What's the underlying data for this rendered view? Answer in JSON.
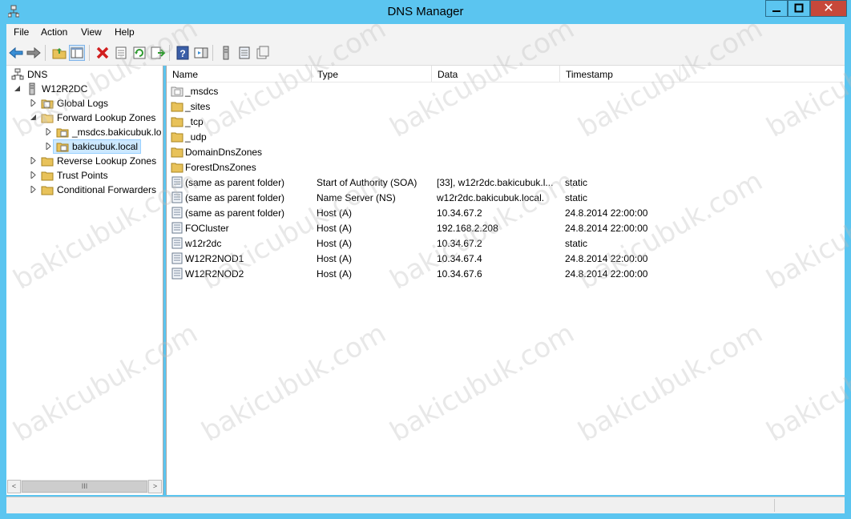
{
  "window": {
    "title": "DNS Manager",
    "close_glyph": "✕"
  },
  "menu": [
    "File",
    "Action",
    "View",
    "Help"
  ],
  "toolbar_icons": [
    "back-arrow-icon",
    "forward-arrow-icon",
    "up-folder-icon",
    "show-hide-console-tree-icon",
    "delete-icon",
    "properties-icon",
    "refresh-icon",
    "export-list-icon",
    "help-icon",
    "show-hide-action-pane-icon",
    "server-icon",
    "zone-icon",
    "record-icon"
  ],
  "tree": {
    "root": "DNS",
    "server": "W12R2DC",
    "nodes": [
      {
        "label": "Global Logs"
      },
      {
        "label": "Forward Lookup Zones"
      },
      {
        "label": "_msdcs.bakicubuk.lo"
      },
      {
        "label": "bakicubuk.local"
      },
      {
        "label": "Reverse Lookup Zones"
      },
      {
        "label": "Trust Points"
      },
      {
        "label": "Conditional Forwarders"
      }
    ]
  },
  "list": {
    "columns": [
      "Name",
      "Type",
      "Data",
      "Timestamp"
    ],
    "rows": [
      {
        "name": "_msdcs",
        "type": "",
        "data": "",
        "timestamp": "",
        "icon": "folder-grey-icon"
      },
      {
        "name": "_sites",
        "type": "",
        "data": "",
        "timestamp": "",
        "icon": "folder-icon"
      },
      {
        "name": "_tcp",
        "type": "",
        "data": "",
        "timestamp": "",
        "icon": "folder-icon"
      },
      {
        "name": "_udp",
        "type": "",
        "data": "",
        "timestamp": "",
        "icon": "folder-icon"
      },
      {
        "name": "DomainDnsZones",
        "type": "",
        "data": "",
        "timestamp": "",
        "icon": "folder-icon"
      },
      {
        "name": "ForestDnsZones",
        "type": "",
        "data": "",
        "timestamp": "",
        "icon": "folder-icon"
      },
      {
        "name": "(same as parent folder)",
        "type": "Start of Authority (SOA)",
        "data": "[33], w12r2dc.bakicubuk.l...",
        "timestamp": "static",
        "icon": "record-icon"
      },
      {
        "name": "(same as parent folder)",
        "type": "Name Server (NS)",
        "data": "w12r2dc.bakicubuk.local.",
        "timestamp": "static",
        "icon": "record-icon"
      },
      {
        "name": "(same as parent folder)",
        "type": "Host (A)",
        "data": "10.34.67.2",
        "timestamp": "24.8.2014 22:00:00",
        "icon": "record-icon"
      },
      {
        "name": "FOCluster",
        "type": "Host (A)",
        "data": "192.168.2.208",
        "timestamp": "24.8.2014 22:00:00",
        "icon": "record-icon"
      },
      {
        "name": "w12r2dc",
        "type": "Host (A)",
        "data": "10.34.67.2",
        "timestamp": "static",
        "icon": "record-icon"
      },
      {
        "name": "W12R2NOD1",
        "type": "Host (A)",
        "data": "10.34.67.4",
        "timestamp": "24.8.2014 22:00:00",
        "icon": "record-icon"
      },
      {
        "name": "W12R2NOD2",
        "type": "Host (A)",
        "data": "10.34.67.6",
        "timestamp": "24.8.2014 22:00:00",
        "icon": "record-icon"
      }
    ]
  },
  "watermark": "bakicubuk.com",
  "scroll_glyphs": {
    "left": "<",
    "right": ">",
    "thumb": "III"
  },
  "colors": {
    "titlebar": "#5bc5f0",
    "close": "#c7483a",
    "selection": "#cce8ff"
  }
}
